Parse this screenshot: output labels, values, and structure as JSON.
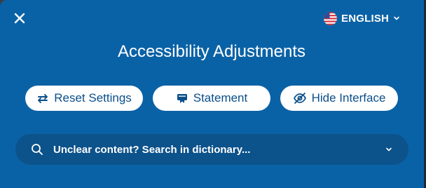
{
  "window": {
    "close_icon": "close-icon"
  },
  "language": {
    "label": "ENGLISH",
    "flag_icon": "us-flag-icon",
    "chevron_icon": "chevron-down-icon"
  },
  "header": {
    "title": "Accessibility Adjustments"
  },
  "actions": [
    {
      "label": "Reset Settings",
      "icon": "reset-arrows-icon"
    },
    {
      "label": "Statement",
      "icon": "statement-icon"
    },
    {
      "label": "Hide Interface",
      "icon": "eye-slash-icon"
    }
  ],
  "search": {
    "text": "Unclear content? Search in dictionary...",
    "icon": "search-icon",
    "chevron_icon": "chevron-down-icon"
  },
  "colors": {
    "panel_bg": "#0a62a6",
    "search_bg": "#0c528b",
    "button_bg": "#ffffff",
    "button_text": "#0a4f8a",
    "text": "#ffffff"
  }
}
